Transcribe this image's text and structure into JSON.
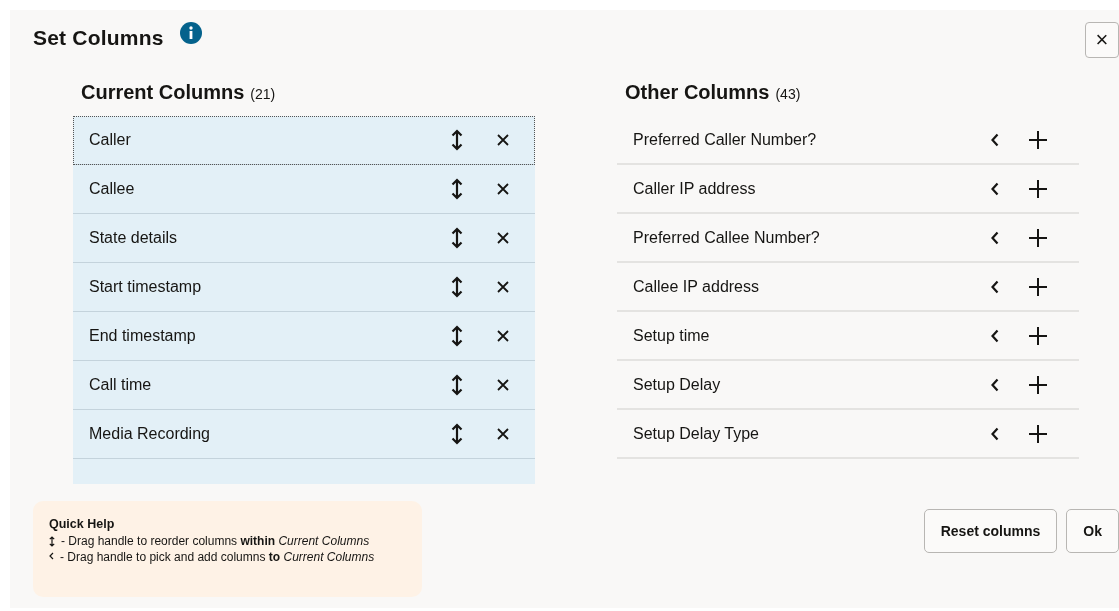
{
  "dialog": {
    "title": "Set Columns",
    "close_label": "×"
  },
  "current_columns": {
    "heading": "Current Columns",
    "count": "(21)",
    "items": [
      {
        "label": "Caller",
        "focused": true
      },
      {
        "label": "Callee",
        "focused": false
      },
      {
        "label": "State details",
        "focused": false
      },
      {
        "label": "Start timestamp",
        "focused": false
      },
      {
        "label": "End timestamp",
        "focused": false
      },
      {
        "label": "Call time",
        "focused": false
      },
      {
        "label": "Media Recording",
        "focused": false
      }
    ]
  },
  "other_columns": {
    "heading": "Other Columns",
    "count": "(43)",
    "items": [
      {
        "label": "Preferred Caller Number?"
      },
      {
        "label": "Caller IP address"
      },
      {
        "label": "Preferred Callee Number?"
      },
      {
        "label": "Callee IP address"
      },
      {
        "label": "Setup time"
      },
      {
        "label": "Setup Delay"
      },
      {
        "label": "Setup Delay Type"
      }
    ]
  },
  "quick_help": {
    "title": "Quick Help",
    "lines": [
      {
        "kind": "reorder",
        "text": "- Drag handle to reorder columns **within** *Current Columns*"
      },
      {
        "kind": "pick",
        "text": "- Drag handle to pick and add columns **to** *Current Columns*"
      }
    ]
  },
  "buttons": [
    "Reset columns",
    "Ok"
  ]
}
